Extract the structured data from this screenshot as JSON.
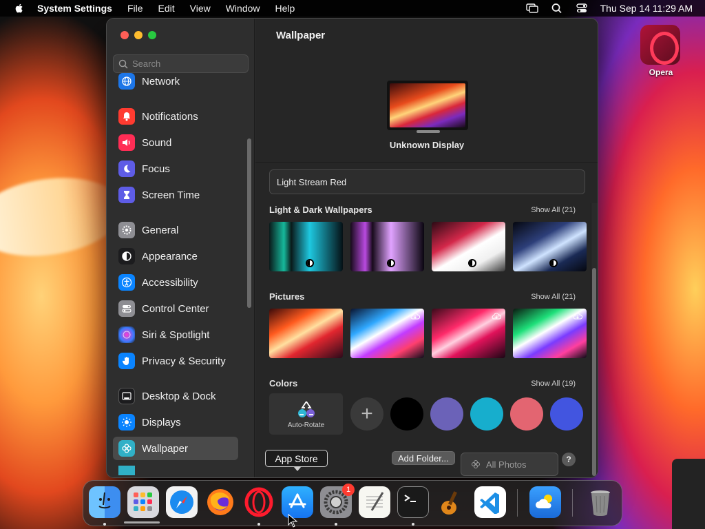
{
  "menubar": {
    "app_name": "System Settings",
    "items": [
      "File",
      "Edit",
      "View",
      "Window",
      "Help"
    ],
    "datetime": "Thu Sep 14  11:29 AM"
  },
  "desktop": {
    "icon_label": "Opera"
  },
  "sidebar": {
    "search_placeholder": "Search",
    "items": [
      {
        "label": "Network",
        "icon": "globe-icon",
        "color": "#1d76e8"
      },
      {
        "label": "Notifications",
        "icon": "bell-icon",
        "color": "#ff3b30"
      },
      {
        "label": "Sound",
        "icon": "speaker-icon",
        "color": "#ff2d55"
      },
      {
        "label": "Focus",
        "icon": "moon-icon",
        "color": "#5e5ce6"
      },
      {
        "label": "Screen Time",
        "icon": "hourglass-icon",
        "color": "#5e5ce6"
      },
      {
        "label": "General",
        "icon": "gear-icon",
        "color": "#8e8e93"
      },
      {
        "label": "Appearance",
        "icon": "contrast-icon",
        "color": "#1c1c1e"
      },
      {
        "label": "Accessibility",
        "icon": "accessibility-icon",
        "color": "#0a84ff"
      },
      {
        "label": "Control Center",
        "icon": "toggles-icon",
        "color": "#8e8e93"
      },
      {
        "label": "Siri & Spotlight",
        "icon": "siri-icon",
        "color": "#7a3cd6"
      },
      {
        "label": "Privacy & Security",
        "icon": "hand-icon",
        "color": "#0a84ff"
      },
      {
        "label": "Desktop & Dock",
        "icon": "dock-icon",
        "color": "#1c1c1e"
      },
      {
        "label": "Displays",
        "icon": "sun-icon",
        "color": "#0a84ff"
      },
      {
        "label": "Wallpaper",
        "icon": "flower-icon",
        "color": "#30b0c7"
      }
    ],
    "selected": "Wallpaper"
  },
  "main": {
    "title": "Wallpaper",
    "display_label": "Unknown Display",
    "current_wallpaper": "Light Stream Red",
    "sections": [
      {
        "heading": "Light & Dark Wallpapers",
        "show_all": "Show All (21)"
      },
      {
        "heading": "Pictures",
        "show_all": "Show All (21)"
      },
      {
        "heading": "Colors",
        "show_all": "Show All (19)"
      }
    ],
    "auto_rotate_label": "Auto-Rotate",
    "color_swatches": [
      "#000000",
      "#6b62b8",
      "#17aecd",
      "#e36571",
      "#4255e0"
    ],
    "add_folder_label": "Add Folder...",
    "photos_select": "All Photos",
    "help_label": "?"
  },
  "tooltip": {
    "text": "App Store"
  },
  "dock": {
    "apps": [
      "Finder",
      "Launchpad",
      "Safari",
      "Firefox",
      "Opera",
      "App Store",
      "System Settings",
      "TextEdit",
      "Terminal",
      "GarageBand",
      "Visual Studio Code",
      "Weather",
      "Trash"
    ],
    "system_settings_badge": "1"
  }
}
